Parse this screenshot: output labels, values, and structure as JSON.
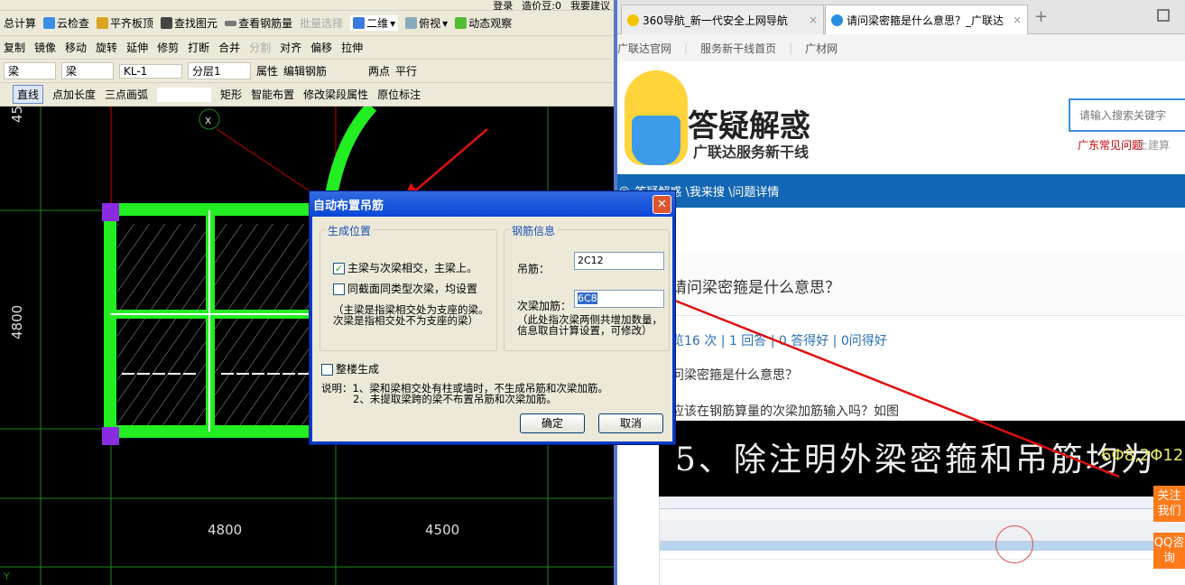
{
  "cad": {
    "top_strip": [
      "登录",
      "造价豆:0",
      "我要建议"
    ],
    "row1": [
      "总计算",
      "云检查",
      "平齐板顶",
      "查找图元",
      "查看钢筋量",
      "批量选择",
      "二维",
      "俯视",
      "动态观察"
    ],
    "row2": [
      "复制",
      "镜像",
      "移动",
      "旋转",
      "延伸",
      "修剪",
      "打断",
      "合并",
      "分割",
      "对齐",
      "偏移",
      "拉伸"
    ],
    "row3": {
      "selects": [
        "梁",
        "梁",
        "KL-1",
        "分层1"
      ],
      "buttons": [
        "属性",
        "编辑钢筋",
        "两点",
        "平行"
      ]
    },
    "row4": [
      "直线",
      "点加长度",
      "三点画弧",
      "矩形",
      "智能布置",
      "修改梁段属性",
      "原位标注"
    ],
    "canvas": {
      "axis_marker": "x",
      "dim_left": "4800",
      "dim_left_top": "45",
      "dim_bottom": [
        "4800",
        "4500"
      ],
      "y_axis": "Y"
    }
  },
  "dialog": {
    "title": "自动布置吊筋",
    "group1": {
      "label": "生成位置",
      "options": [
        {
          "label": "主梁与次梁相交，主梁上。",
          "checked": true
        },
        {
          "label": "同截面同类型次梁，均设置",
          "checked": false
        }
      ],
      "note": "（主梁是指梁相交处为支座的梁。次梁是指相交处不为支座的梁）"
    },
    "group2": {
      "label": "钢筋信息",
      "hanger_label": "吊筋：",
      "hanger_value": "2C12",
      "secondary_label": "次梁加筋：",
      "secondary_value": "6C8",
      "note": "（此处指次梁两侧共增加数量，信息取自计算设置，可修改）"
    },
    "whole_building": {
      "label": "整楼生成",
      "checked": false
    },
    "explanation_1": "说明：1、梁和梁相交处有柱或墙时，不生成吊筋和次梁加筋。",
    "explanation_2": "2、未提取梁跨的梁不布置吊筋和次梁加筋。",
    "ok": "确定",
    "cancel": "取消"
  },
  "browser": {
    "tabs": [
      {
        "title": "360导航_新一代安全上网导航"
      },
      {
        "title": "请问梁密箍是什么意思？_广联达"
      }
    ],
    "bookmarks": [
      "广联达官网",
      "服务新干线首页",
      "广材网"
    ],
    "logo_title": "答疑解惑",
    "logo_subtitle": "广联达服务新干线",
    "search_placeholder": "请输入搜索关键字",
    "hot_links": [
      "广东常见问题",
      "土建算"
    ],
    "breadcrumb": "答疑解惑 \\我来搜 \\问题详情",
    "question_title": "请问梁密箍是什么意思？",
    "stats": "览16 次 | 1 回答 | 0 答得好 | 0问得好",
    "body_1": "问梁密箍是什么意思？",
    "body_2": "应该在钢筋算量的次梁加筋输入吗？如图",
    "image_text": "5、除注明外梁密箍和吊筋均为",
    "image_text_yellow": "6Φ8,2Φ12",
    "follow_us": "关注我们",
    "qq": "QQ咨询"
  },
  "colors": {
    "beam": "#22ee22",
    "grid": "#1a8a1a",
    "arrow": "#e01010",
    "nav": "#1366b3",
    "orange": "#ff7a1a"
  }
}
